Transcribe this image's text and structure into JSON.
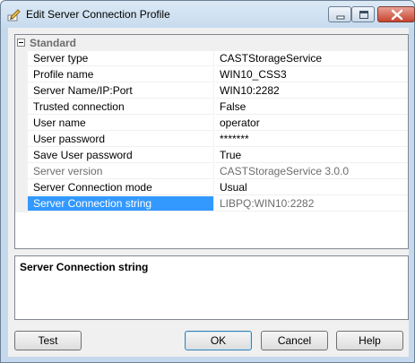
{
  "window": {
    "title": "Edit Server Connection Profile"
  },
  "grid": {
    "category": "Standard",
    "rows": [
      {
        "name": "Server type",
        "value": "CASTStorageService"
      },
      {
        "name": "Profile name",
        "value": "WIN10_CSS3"
      },
      {
        "name": "Server Name/IP:Port",
        "value": "WIN10:2282"
      },
      {
        "name": "Trusted connection",
        "value": "False"
      },
      {
        "name": "User name",
        "value": "operator"
      },
      {
        "name": "User password",
        "value": "*******"
      },
      {
        "name": "Save User password",
        "value": "True"
      },
      {
        "name": "Server version",
        "value": "CASTStorageService 3.0.0"
      },
      {
        "name": "Server Connection mode",
        "value": "Usual"
      },
      {
        "name": "Server Connection string",
        "value": "LIBPQ:WIN10:2282"
      }
    ]
  },
  "description": {
    "title": "Server Connection string"
  },
  "buttons": {
    "test": "Test",
    "ok": "OK",
    "cancel": "Cancel",
    "help": "Help"
  },
  "icons": {
    "app": "pencil-icon",
    "minimize": "minimize-icon",
    "maximize": "maximize-icon",
    "close": "close-icon",
    "collapse": "collapse-icon"
  },
  "colors": {
    "selection": "#3399ff",
    "readonly_text": "#6d6d6d",
    "close_button": "#c7442f"
  }
}
